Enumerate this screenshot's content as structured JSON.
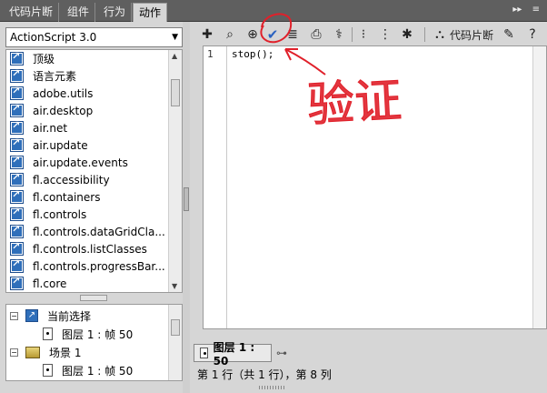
{
  "tabs": [
    {
      "label": "代码片断",
      "active": false
    },
    {
      "label": "组件",
      "active": false
    },
    {
      "label": "行为",
      "active": false
    },
    {
      "label": "动作",
      "active": true
    }
  ],
  "tab_buttons": [
    "▸▸",
    "≡"
  ],
  "language_select": {
    "value": "ActionScript 3.0"
  },
  "package_tree": [
    "顶级",
    "语言元素",
    "adobe.utils",
    "air.desktop",
    "air.net",
    "air.update",
    "air.update.events",
    "fl.accessibility",
    "fl.containers",
    "fl.controls",
    "fl.controls.dataGridCla...",
    "fl.controls.listClasses",
    "fl.controls.progressBar...",
    "fl.core"
  ],
  "script_navigator": {
    "current_selection": "当前选择",
    "current_item": "图层 1 : 帧 50",
    "scene": "场景 1",
    "scene_item": "图层 1 : 帧 50"
  },
  "toolbar": {
    "icons": [
      "add-statement-icon",
      "find-icon",
      "target-path-icon",
      "check-syntax-icon",
      "auto-format-icon",
      "code-hint-icon",
      "debug-options-icon",
      "collapse-between-braces-icon",
      "collapse-selection-icon",
      "expand-all-icon",
      "code-snippets-icon",
      "help-icon"
    ],
    "snippets_label": "代码片断"
  },
  "editor": {
    "line_number": "1",
    "code": "stop();"
  },
  "layer_tab": {
    "label": "图层 1 : 50"
  },
  "status": "第 1 行（共 1 行），第 8 列",
  "annotation": {
    "text": "验证",
    "color": "#e0202a"
  },
  "colors": {
    "tab_bar": "#5f5f5f",
    "panel": "#d6d6d6",
    "accent": "#2a62c0"
  }
}
